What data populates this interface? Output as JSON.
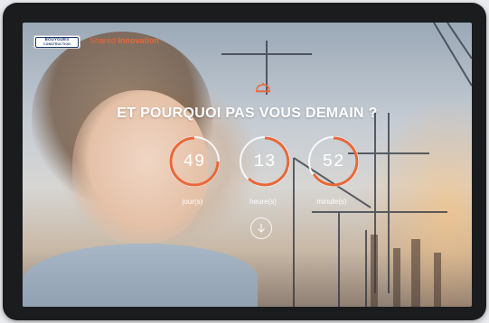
{
  "header": {
    "logo_line1": "BOUYGUES",
    "logo_line2": "CONSTRUCTION",
    "tagline_prefix": "Shared ",
    "tagline_strong": "Innovation"
  },
  "hero": {
    "title": "ET POURQUOI PAS VOUS DEMAIN ?",
    "icon": "hard-hat-icon"
  },
  "countdown": [
    {
      "value": "49",
      "label": "jour(s)"
    },
    {
      "value": "13",
      "label": "heure(s)"
    },
    {
      "value": "52",
      "label": "minute(s)"
    }
  ],
  "scroll": {
    "icon": "arrow-down-icon"
  },
  "colors": {
    "accent": "#e8683a",
    "ring_track": "#ffffff",
    "brand_blue": "#1d3a6e"
  }
}
